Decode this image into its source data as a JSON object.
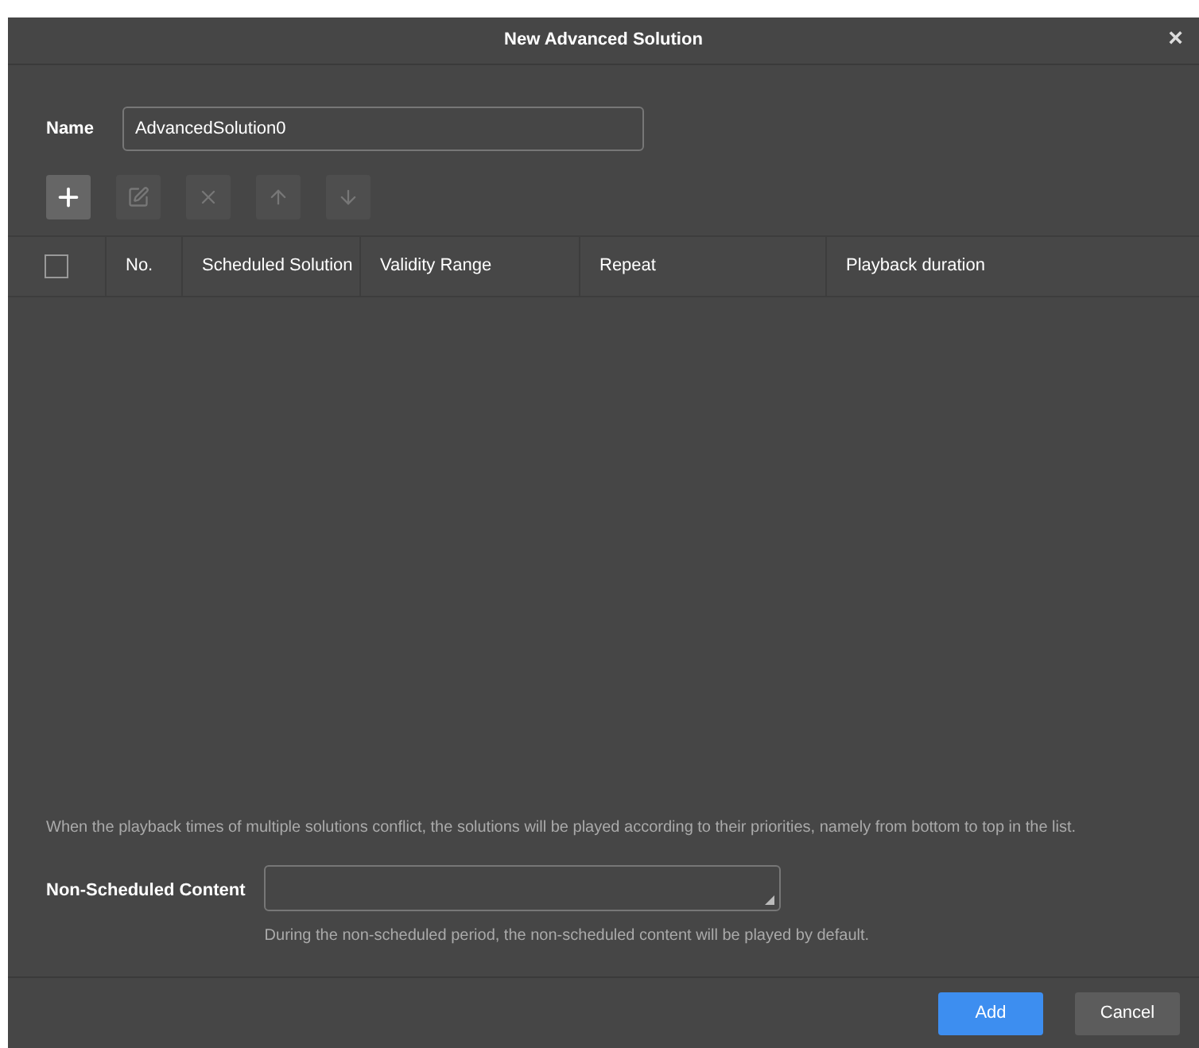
{
  "window": {
    "title": "New Advanced Solution",
    "close": "×"
  },
  "name_field": {
    "label": "Name",
    "value": "AdvancedSolution0"
  },
  "toolbar": [
    {
      "kind": "add",
      "disabled": false
    },
    {
      "kind": "edit",
      "disabled": true
    },
    {
      "kind": "delete",
      "disabled": true
    },
    {
      "kind": "up",
      "disabled": true
    },
    {
      "kind": "down",
      "disabled": true
    }
  ],
  "table": {
    "select_all": {
      "checked": false
    },
    "columns": [
      "No.",
      "Scheduled Solution",
      "Validity Range",
      "Repeat",
      "Playback duration"
    ]
  },
  "note": "When the playback times of multiple solutions conflict, the solutions will be played according to their priorities, namely from bottom to top in the list.",
  "non_scheduled": {
    "label": "Non-Scheduled Content",
    "hint": "During the non-scheduled period, the non-scheduled content will be played by default."
  },
  "buttons": [
    {
      "label": "Add",
      "kind": "primary"
    },
    {
      "label": "Cancel",
      "kind": "secondary"
    }
  ]
}
